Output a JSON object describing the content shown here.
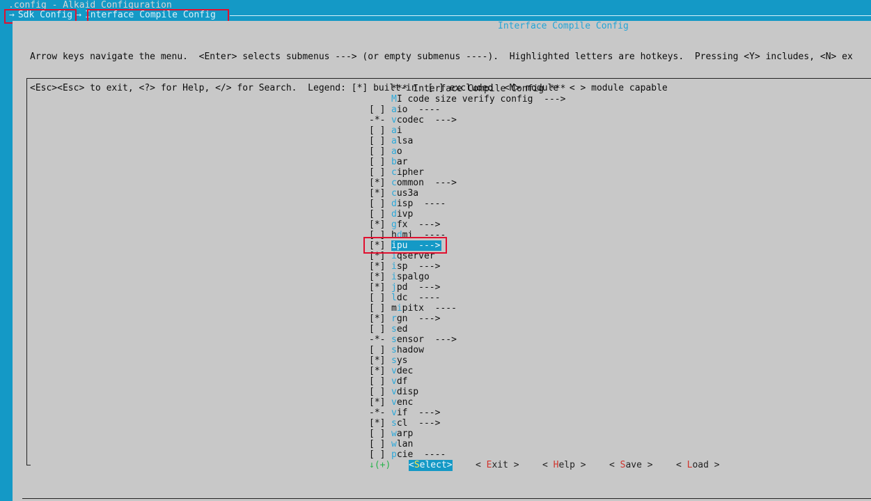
{
  "window": {
    "title": ".config - Alkaid Configuration"
  },
  "breadcrumb": {
    "arrow": "→",
    "items": [
      "Sdk Config",
      "Interface Compile Config"
    ]
  },
  "panel": {
    "title": "Interface Compile Config",
    "help_lines": [
      "Arrow keys navigate the menu.  <Enter> selects submenus ---> (or empty submenus ----).  Highlighted letters are hotkeys.  Pressing <Y> includes, <N> ex",
      "<Esc><Esc> to exit, <?> for Help, </> for Search.  Legend: [*] built-in  [ ] excluded  <M> module  < > module capable"
    ]
  },
  "menu": {
    "header": "*** Interface Compile Config ***",
    "items": [
      {
        "state": "",
        "hot": "M",
        "pre": "",
        "rest": "I code size verify config",
        "suffix": "  --->"
      },
      {
        "state": "[ ]",
        "hot": "a",
        "pre": "",
        "rest": "io",
        "suffix": "  ----"
      },
      {
        "state": "-*-",
        "hot": "v",
        "pre": "",
        "rest": "codec",
        "suffix": "  --->"
      },
      {
        "state": "[ ]",
        "hot": "a",
        "pre": "",
        "rest": "i",
        "suffix": ""
      },
      {
        "state": "[ ]",
        "hot": "a",
        "pre": "",
        "rest": "lsa",
        "suffix": ""
      },
      {
        "state": "[ ]",
        "hot": "a",
        "pre": "",
        "rest": "o",
        "suffix": ""
      },
      {
        "state": "[ ]",
        "hot": "b",
        "pre": "",
        "rest": "ar",
        "suffix": ""
      },
      {
        "state": "[ ]",
        "hot": "c",
        "pre": "",
        "rest": "ipher",
        "suffix": ""
      },
      {
        "state": "[*]",
        "hot": "c",
        "pre": "",
        "rest": "ommon",
        "suffix": "  --->"
      },
      {
        "state": "[*]",
        "hot": "c",
        "pre": "",
        "rest": "us3a",
        "suffix": ""
      },
      {
        "state": "[ ]",
        "hot": "d",
        "pre": "",
        "rest": "isp",
        "suffix": "  ----"
      },
      {
        "state": "[ ]",
        "hot": "d",
        "pre": "",
        "rest": "ivp",
        "suffix": ""
      },
      {
        "state": "[*]",
        "hot": "g",
        "pre": "",
        "rest": "fx",
        "suffix": "  --->"
      },
      {
        "state": "[ ]",
        "hot": "d",
        "pre": "h",
        "rest": "mi",
        "suffix": "  ----"
      },
      {
        "state": "[*]",
        "hot": "i",
        "pre": "",
        "rest": "pu",
        "suffix": "  --->",
        "selected": true
      },
      {
        "state": "[*]",
        "hot": "i",
        "pre": "",
        "rest": "qserver",
        "suffix": ""
      },
      {
        "state": "[*]",
        "hot": "i",
        "pre": "",
        "rest": "sp",
        "suffix": "  --->"
      },
      {
        "state": "[*]",
        "hot": "i",
        "pre": "",
        "rest": "spalgo",
        "suffix": ""
      },
      {
        "state": "[*]",
        "hot": "j",
        "pre": "",
        "rest": "pd",
        "suffix": "  --->"
      },
      {
        "state": "[ ]",
        "hot": "l",
        "pre": "",
        "rest": "dc",
        "suffix": "  ----"
      },
      {
        "state": "[ ]",
        "hot": "i",
        "pre": "m",
        "rest": "pitx",
        "suffix": "  ----"
      },
      {
        "state": "[*]",
        "hot": "r",
        "pre": "",
        "rest": "gn",
        "suffix": "  --->"
      },
      {
        "state": "[ ]",
        "hot": "s",
        "pre": "",
        "rest": "ed",
        "suffix": ""
      },
      {
        "state": "-*-",
        "hot": "s",
        "pre": "",
        "rest": "ensor",
        "suffix": "  --->"
      },
      {
        "state": "[ ]",
        "hot": "s",
        "pre": "",
        "rest": "hadow",
        "suffix": ""
      },
      {
        "state": "[*]",
        "hot": "s",
        "pre": "",
        "rest": "ys",
        "suffix": ""
      },
      {
        "state": "[*]",
        "hot": "v",
        "pre": "",
        "rest": "dec",
        "suffix": ""
      },
      {
        "state": "[ ]",
        "hot": "v",
        "pre": "",
        "rest": "df",
        "suffix": ""
      },
      {
        "state": "[ ]",
        "hot": "v",
        "pre": "",
        "rest": "disp",
        "suffix": ""
      },
      {
        "state": "[*]",
        "hot": "v",
        "pre": "",
        "rest": "enc",
        "suffix": ""
      },
      {
        "state": "-*-",
        "hot": "v",
        "pre": "",
        "rest": "if",
        "suffix": "  --->"
      },
      {
        "state": "[*]",
        "hot": "s",
        "pre": "",
        "rest": "cl",
        "suffix": "  --->"
      },
      {
        "state": "[ ]",
        "hot": "w",
        "pre": "",
        "rest": "arp",
        "suffix": ""
      },
      {
        "state": "[ ]",
        "hot": "w",
        "pre": "",
        "rest": "lan",
        "suffix": ""
      },
      {
        "state": "[ ]",
        "hot": "p",
        "pre": "",
        "rest": "cie",
        "suffix": "  ----"
      }
    ],
    "more_indicator": "↓(+)"
  },
  "buttons": [
    {
      "pre": "<",
      "hot": "S",
      "rest": "elect",
      "post": ">",
      "active": true
    },
    {
      "pre": "< ",
      "hot": "E",
      "rest": "xit",
      "post": " >",
      "active": false
    },
    {
      "pre": "< ",
      "hot": "H",
      "rest": "elp",
      "post": " >",
      "active": false
    },
    {
      "pre": "< ",
      "hot": "S",
      "rest": "ave",
      "post": " >",
      "active": false
    },
    {
      "pre": "< ",
      "hot": "L",
      "rest": "oad",
      "post": " >",
      "active": false
    }
  ],
  "colors": {
    "background": "#1499c6",
    "panel": "#c8c8c8",
    "hotkey": "#2ea8d8",
    "annotation": "#e0102f"
  }
}
